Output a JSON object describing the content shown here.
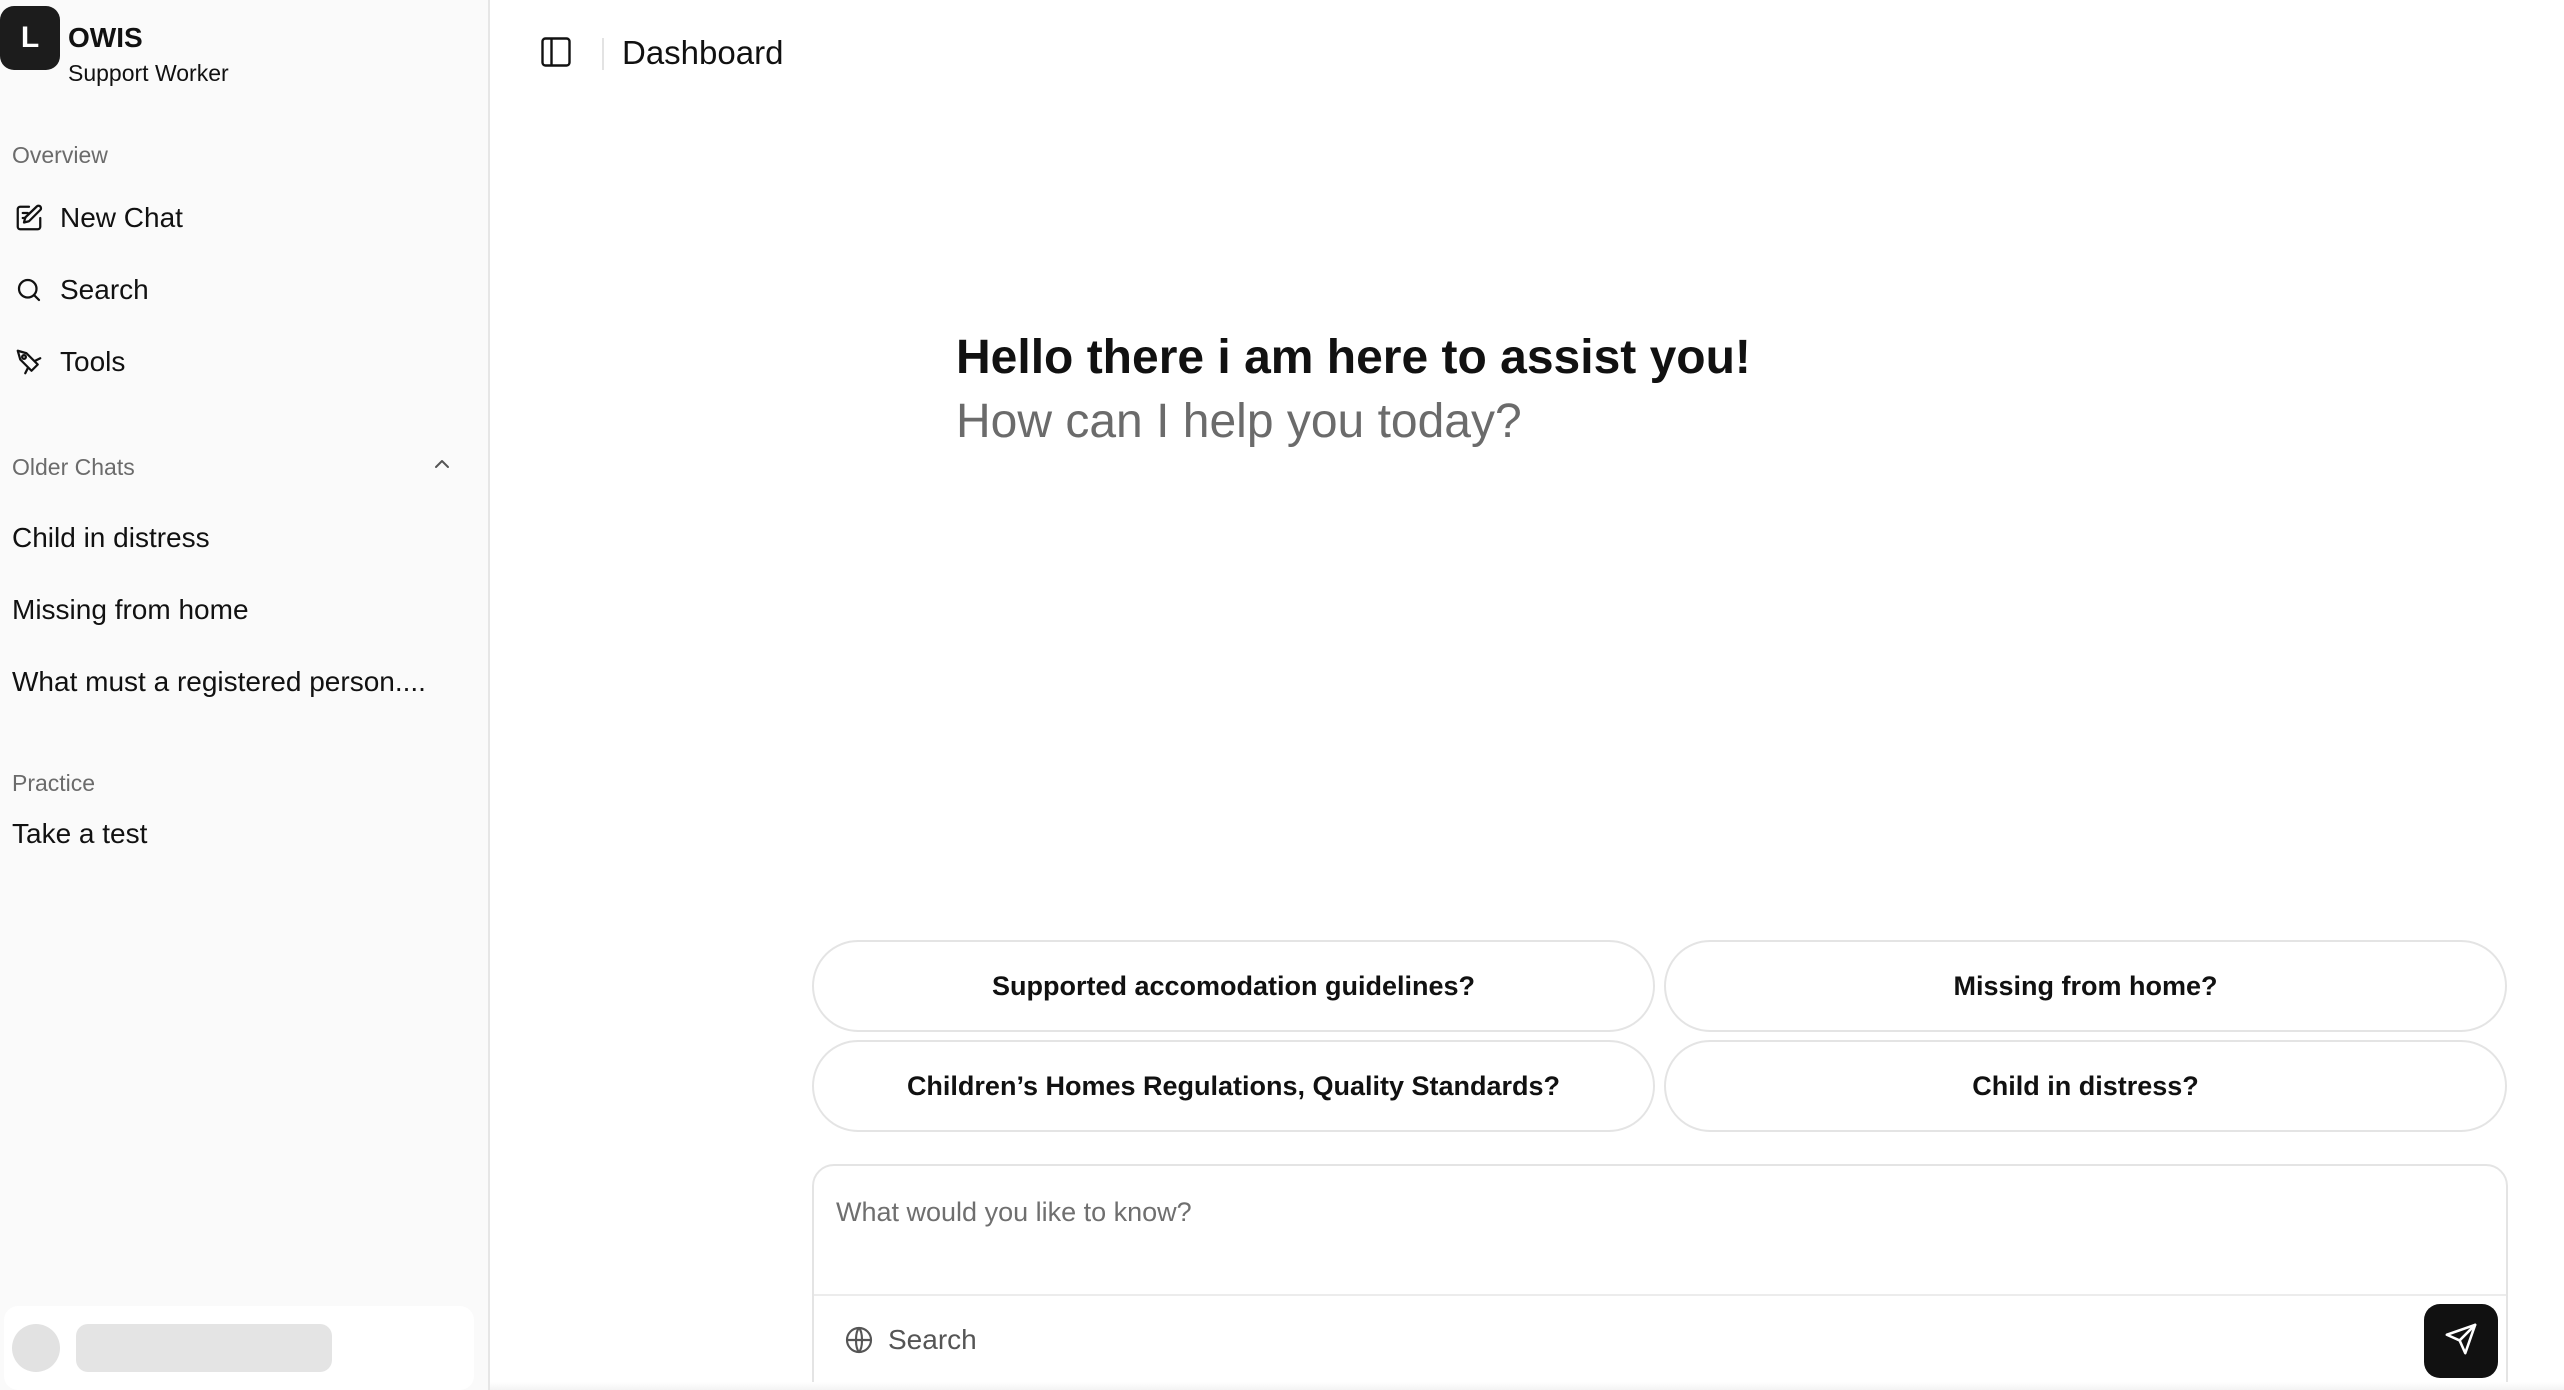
{
  "app": {
    "logo_letter": "L",
    "name": "OWIS",
    "role": "Support Worker"
  },
  "sidebar": {
    "overview_label": "Overview",
    "nav": [
      {
        "label": "New Chat",
        "icon": "new-chat-icon"
      },
      {
        "label": "Search",
        "icon": "search-icon"
      },
      {
        "label": "Tools",
        "icon": "tools-icon"
      }
    ],
    "older_chats_label": "Older Chats",
    "older_chats": [
      "Child in distress",
      "Missing from home",
      "What must a registered person...."
    ],
    "practice_label": "Practice",
    "practice_items": [
      "Take a test"
    ]
  },
  "header": {
    "title": "Dashboard"
  },
  "greeting": {
    "title": "Hello there i am here to assist you!",
    "subtitle": "How can I help you today?"
  },
  "suggestions": [
    "Supported accomodation guidelines?",
    "Missing from home?",
    "Children’s Homes Regulations, Quality Standards?",
    "Child in distress?"
  ],
  "composer": {
    "placeholder": "What would you like to know?",
    "search_label": "Search"
  },
  "colors": {
    "sidebar_bg": "#fafafa",
    "accent": "#111111",
    "muted_text": "#6b6b6b"
  }
}
